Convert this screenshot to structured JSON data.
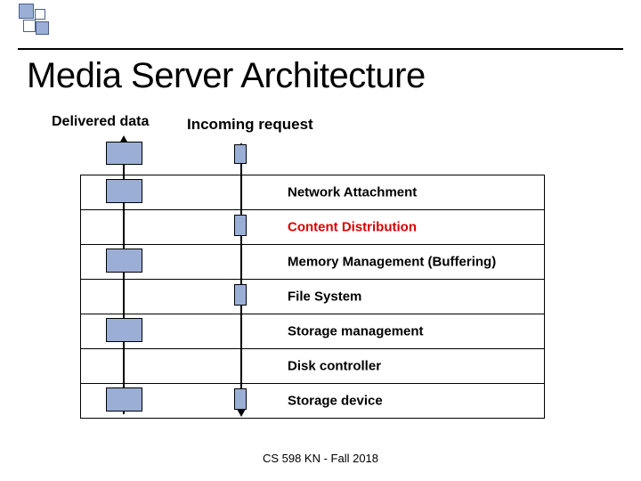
{
  "title": "Media Server Architecture",
  "labels": {
    "delivered": "Delivered data",
    "incoming": "Incoming request"
  },
  "layers": [
    {
      "label": "Network Attachment",
      "red": false
    },
    {
      "label": "Content  Distribution",
      "red": true
    },
    {
      "label": "Memory Management (Buffering)",
      "red": false
    },
    {
      "label": "File System",
      "red": false
    },
    {
      "label": "Storage management",
      "red": false
    },
    {
      "label": "Disk controller",
      "red": false
    },
    {
      "label": "Storage device",
      "red": false
    }
  ],
  "footer": "CS 598 KN - Fall 2018",
  "colors": {
    "box_fill": "#9bafd6",
    "box_border": "#000000",
    "red_text": "#d80000"
  }
}
